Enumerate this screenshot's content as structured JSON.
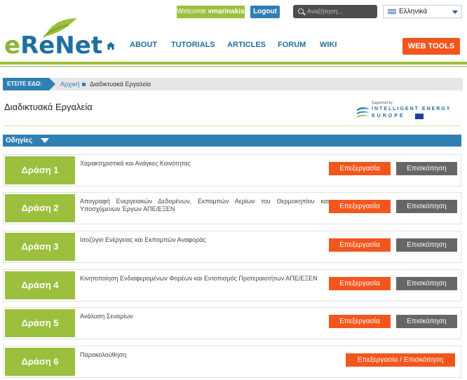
{
  "header": {
    "logo": {
      "first_letter": "e",
      "rest": "ReNet"
    },
    "welcome_prefix": "Welcome",
    "username": "vmarinakis",
    "logout_label": "Logout",
    "search_placeholder": "Αναζήτηση...",
    "language": "Ελληνικά",
    "nav": {
      "about": "ABOUT",
      "tutorials": "TUTORIALS",
      "articles": "ARTICLES",
      "forum": "FORUM",
      "wiki": "WIKI"
    },
    "web_tools": "WEB TOOLS"
  },
  "breadcrumb": {
    "label": "ΕΤΣΙΤΕ ΕΔΩ:",
    "home": "Αρχική",
    "current": "Διαδικτυακά Εργαλεία"
  },
  "page": {
    "title": "Διαδικτυακά Εργαλεία",
    "supported_by": "Supported by",
    "sponsor_line1": "INTELLIGENT ENERGY",
    "sponsor_line2": "EUROPE",
    "instructions": "Οδηγίες"
  },
  "actions": [
    {
      "label": "Δράση 1",
      "desc": "Χαρακτηριστικά και Ανάγκες Κοινότητας",
      "edit": "Επεξεργασία",
      "view": "Επισκόπηση"
    },
    {
      "label": "Δράση 2",
      "desc": "Απογραφή Ενεργειακών Δεδομένων, Εκπομπών Αερίων του Θερμοκηπίου και Υποσχόμενων Έργων ΑΠΕ/ΕΞΕΝ",
      "edit": "Επεξεργασία",
      "view": "Επισκόπηση"
    },
    {
      "label": "Δράση 3",
      "desc": "Ισοζύγιο Ενέργειας και Εκπομπών Αναφοράς",
      "edit": "Επεξεργασία",
      "view": "Επισκόπηση"
    },
    {
      "label": "Δράση 4",
      "desc": "Κινητοποίηση Ενδιαφερομένων Φορέων και Εντοπισμός Προτεραιοτήτων ΑΠΕ/ΕΞΕΝ",
      "edit": "Επεξεργασία",
      "view": "Επισκόπηση"
    },
    {
      "label": "Δράση 5",
      "desc": "Ανάλυση Σεναρίων",
      "edit": "Επεξεργασία",
      "view": "Επισκόπηση"
    },
    {
      "label": "Δράση 6",
      "desc": "Παρακολούθηση",
      "edit_view": "Επεξεργασία / Επισκόπηση"
    }
  ],
  "colors": {
    "green": "#9cbf3d",
    "blue": "#2f7fb5",
    "orange": "#f2561d",
    "gray_button": "#666666"
  }
}
